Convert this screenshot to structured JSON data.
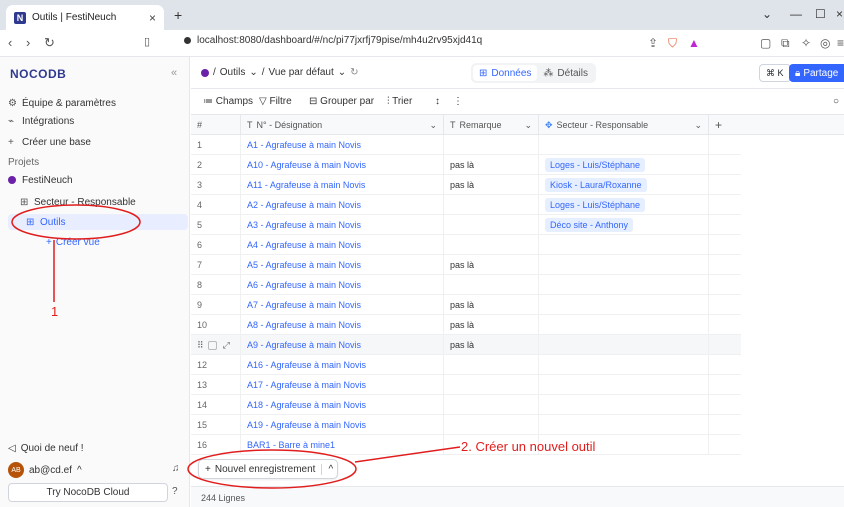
{
  "browser": {
    "tab_title": "Outils | FestiNeuch",
    "favicon": "N",
    "url": "localhost:8080/dashboard/#/nc/pi77jxrfj79pise/mh4u2rv95xjd41q"
  },
  "sidebar": {
    "logo": "NOCODB",
    "items": [
      {
        "label": "Équipe & paramètres",
        "icon": "gear-icon"
      },
      {
        "label": "Intégrations",
        "icon": "plug-icon"
      },
      {
        "label": "Créer une base",
        "icon": "plus-icon"
      }
    ],
    "projects_label": "Projets",
    "project": "FestiNeuch",
    "tables": [
      {
        "label": "Secteur - Responsable"
      },
      {
        "label": "Outils"
      }
    ],
    "create_view": "Créer vue",
    "whats_new": "Quoi de neuf !",
    "user": "ab@cd.ef",
    "user_initials": "AB",
    "cloud": "Try NocoDB Cloud"
  },
  "header": {
    "crumb_table": "Outils",
    "crumb_view": "Vue par défaut",
    "tab_data": "Données",
    "tab_details": "Détails",
    "shortcut": "⌘ K",
    "share": "Partage"
  },
  "toolbar": {
    "fields": "Champs",
    "filter": "Filtre",
    "group": "Grouper par",
    "sort": "Trier"
  },
  "grid": {
    "columns": [
      "#",
      "N° - Désignation",
      "Remarque",
      "Secteur - Responsable"
    ],
    "rows": [
      {
        "n": "1",
        "des": "A1 - Agrafeuse à main Novis",
        "rem": "",
        "sec": ""
      },
      {
        "n": "2",
        "des": "A10 - Agrafeuse à main Novis",
        "rem": "pas là",
        "sec": "Loges - Luis/Stéphane"
      },
      {
        "n": "3",
        "des": "A11 - Agrafeuse à main Novis",
        "rem": "pas là",
        "sec": "Kiosk - Laura/Roxanne"
      },
      {
        "n": "4",
        "des": "A2 - Agrafeuse à main Novis",
        "rem": "",
        "sec": "Loges - Luis/Stéphane"
      },
      {
        "n": "5",
        "des": "A3 - Agrafeuse à main Novis",
        "rem": "",
        "sec": "Déco site - Anthony"
      },
      {
        "n": "6",
        "des": "A4 - Agrafeuse à main Novis",
        "rem": "",
        "sec": ""
      },
      {
        "n": "7",
        "des": "A5 - Agrafeuse à main Novis",
        "rem": "pas là",
        "sec": ""
      },
      {
        "n": "8",
        "des": "A6 - Agrafeuse à main Novis",
        "rem": "",
        "sec": ""
      },
      {
        "n": "9",
        "des": "A7 - Agrafeuse à main Novis",
        "rem": "pas là",
        "sec": ""
      },
      {
        "n": "10",
        "des": "A8 - Agrafeuse à main Novis",
        "rem": "pas là",
        "sec": ""
      },
      {
        "n": "",
        "des": "A9 - Agrafeuse à main Novis",
        "rem": "pas là",
        "sec": ""
      },
      {
        "n": "12",
        "des": "A16 - Agrafeuse à main Novis",
        "rem": "",
        "sec": ""
      },
      {
        "n": "13",
        "des": "A17 - Agrafeuse à main Novis",
        "rem": "",
        "sec": ""
      },
      {
        "n": "14",
        "des": "A18 - Agrafeuse à main Novis",
        "rem": "",
        "sec": ""
      },
      {
        "n": "15",
        "des": "A19 - Agrafeuse à main Novis",
        "rem": "",
        "sec": ""
      },
      {
        "n": "16",
        "des": "BAR1 - Barre à mine1",
        "rem": "",
        "sec": ""
      }
    ],
    "new_record": "Nouvel enregistrement",
    "count": "244 Lignes"
  },
  "annotations": {
    "one": "1",
    "two": "2. Créer un nouvel outil",
    "color": "#e11d1d"
  }
}
